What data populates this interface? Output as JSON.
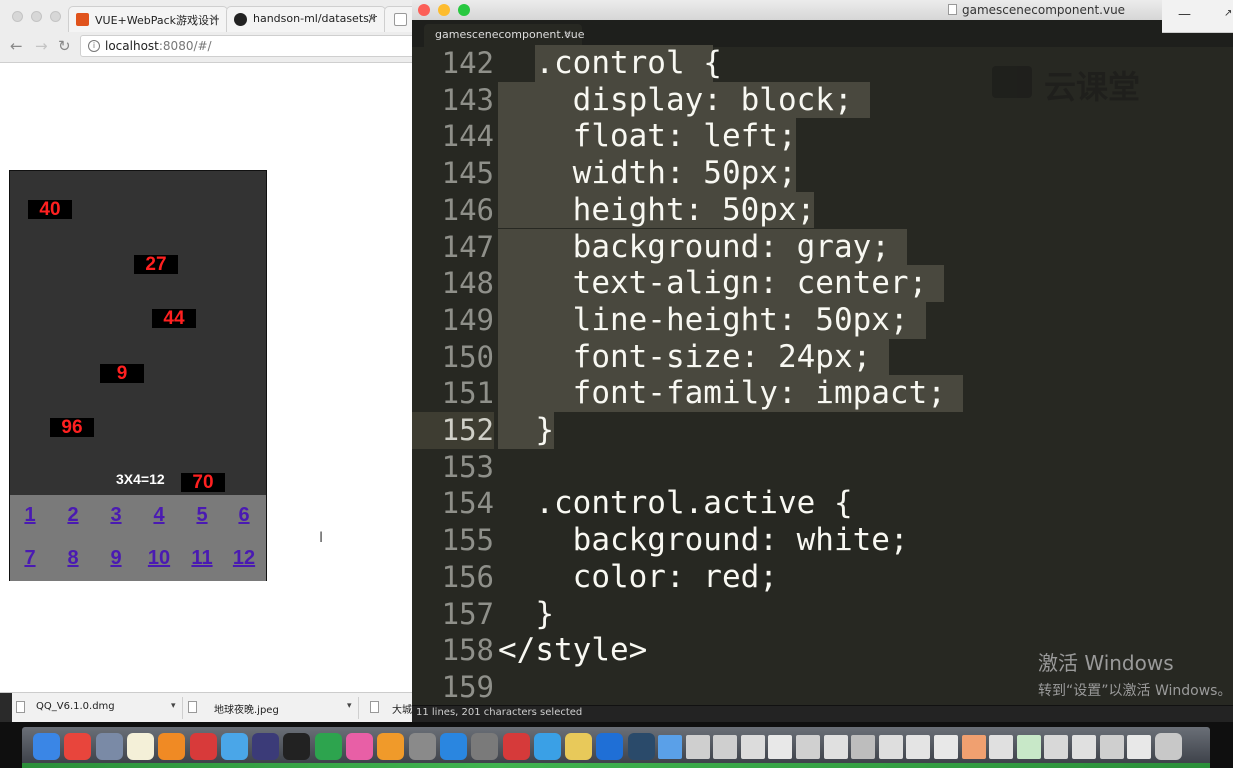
{
  "browser": {
    "tabs": [
      {
        "label": "VUE+WebPack游戏设计",
        "close": "×"
      },
      {
        "label": "handson-ml/datasets/h",
        "close": "×"
      }
    ],
    "nav": {
      "back": "←",
      "forward": "→",
      "reload": "↻"
    },
    "url_host": "localhost",
    "url_rest": ":8080/#/"
  },
  "game": {
    "bubbles": [
      "40",
      "27",
      "44",
      "9",
      "96",
      "70"
    ],
    "equation": "3X4=12",
    "controls": [
      "1",
      "2",
      "3",
      "4",
      "5",
      "6",
      "7",
      "8",
      "9",
      "10",
      "11",
      "12"
    ]
  },
  "editor": {
    "window_title": "gamescenecomponent.vue",
    "tab_label": "gamescenecomponent.vue",
    "tab_close": "×",
    "lines": [
      {
        "num": "142",
        "text": "  .control {"
      },
      {
        "num": "143",
        "text": "    display: block;"
      },
      {
        "num": "144",
        "text": "    float: left;"
      },
      {
        "num": "145",
        "text": "    width: 50px;"
      },
      {
        "num": "146",
        "text": "    height: 50px;"
      },
      {
        "num": "147",
        "text": "    background: gray;"
      },
      {
        "num": "148",
        "text": "    text-align: center;"
      },
      {
        "num": "149",
        "text": "    line-height: 50px;"
      },
      {
        "num": "150",
        "text": "    font-size: 24px;"
      },
      {
        "num": "151",
        "text": "    font-family: impact;"
      },
      {
        "num": "152",
        "text": "  }"
      },
      {
        "num": "153",
        "text": ""
      },
      {
        "num": "154",
        "text": "  .control.active {"
      },
      {
        "num": "155",
        "text": "    background: white;"
      },
      {
        "num": "156",
        "text": "    color: red;"
      },
      {
        "num": "157",
        "text": "  }"
      },
      {
        "num": "158",
        "text": "</style>"
      },
      {
        "num": "159",
        "text": ""
      }
    ],
    "status": "11 lines, 201 characters selected",
    "watermark": "云课堂"
  },
  "activation": {
    "title": "激活 Windows",
    "subtitle": "转到“设置”以激活 Windows。"
  },
  "side_window": {
    "minimize": "—",
    "expand": "↗"
  },
  "downloads": [
    {
      "name": "QQ_V6.1.0.dmg",
      "caret": "▾"
    },
    {
      "name": "地球夜晚.jpeg",
      "caret": "▾"
    },
    {
      "name": "大城",
      "caret": ""
    }
  ],
  "colors": {
    "editor_bg": "#272822",
    "selection": "#49483e",
    "bubble_text": "#ff2020",
    "control_text": "#4a1ab2",
    "control_bg": "#7a7a7a",
    "game_bg": "#333333"
  }
}
